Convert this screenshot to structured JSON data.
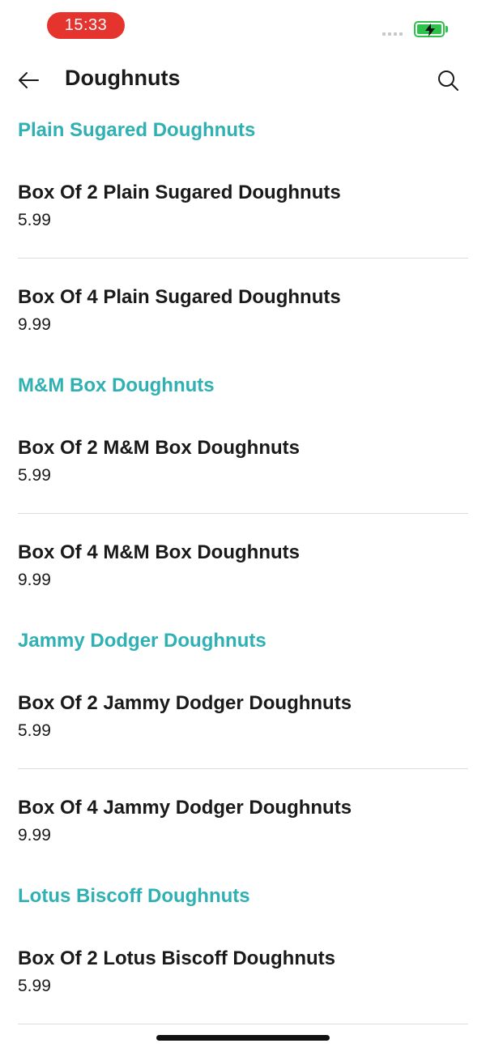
{
  "status": {
    "time": "15:33"
  },
  "header": {
    "title": "Doughnuts"
  },
  "sections": [
    {
      "title": "Plain Sugared Doughnuts",
      "items": [
        {
          "name": "Box Of 2 Plain Sugared Doughnuts",
          "price": "5.99"
        },
        {
          "name": "Box Of 4 Plain Sugared Doughnuts",
          "price": "9.99"
        }
      ]
    },
    {
      "title": "M&M Box Doughnuts",
      "items": [
        {
          "name": "Box Of 2 M&M Box Doughnuts",
          "price": "5.99"
        },
        {
          "name": "Box Of 4 M&M Box Doughnuts",
          "price": "9.99"
        }
      ]
    },
    {
      "title": "Jammy Dodger Doughnuts",
      "items": [
        {
          "name": "Box Of 2 Jammy Dodger Doughnuts",
          "price": "5.99"
        },
        {
          "name": "Box Of 4 Jammy Dodger Doughnuts",
          "price": "9.99"
        }
      ]
    },
    {
      "title": "Lotus Biscoff Doughnuts",
      "items": [
        {
          "name": "Box Of 2 Lotus Biscoff Doughnuts",
          "price": "5.99"
        }
      ]
    }
  ],
  "colors": {
    "accent": "#2fb0b3",
    "time_pill": "#e5332d",
    "battery": "#2fc24b"
  },
  "icons": {
    "back": "arrow-left-icon",
    "search": "search-icon"
  }
}
